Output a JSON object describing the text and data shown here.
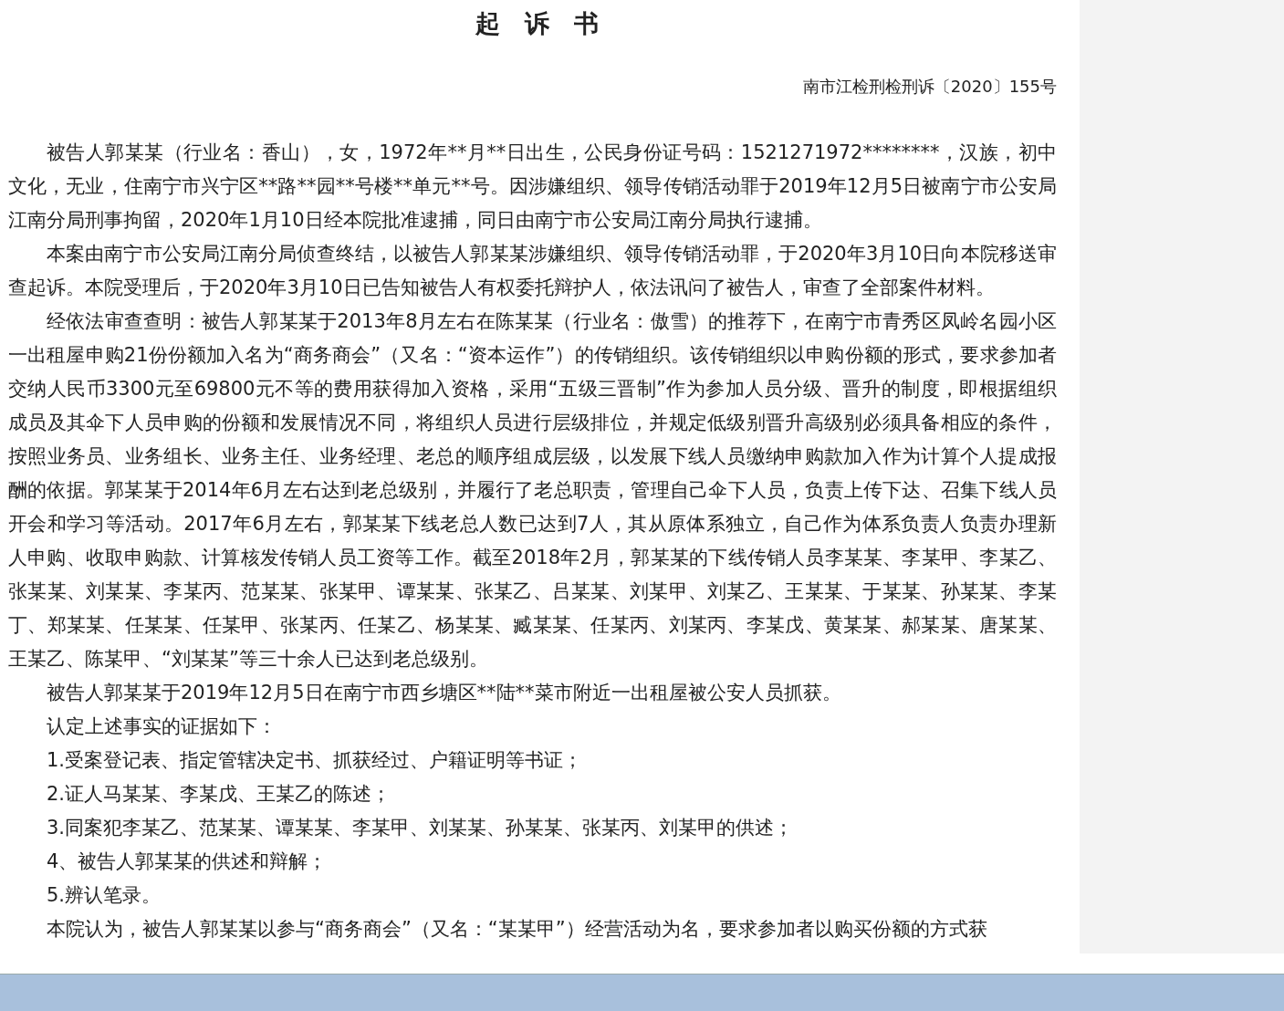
{
  "document": {
    "title": "起　诉　书",
    "case_number": "南市江检刑检刑诉〔2020〕155号",
    "paragraphs": [
      "被告人郭某某（行业名：香山），女，1972年**月**日出生，公民身份证号码：1521271972********，汉族，初中文化，无业，住南宁市兴宁区**路**园**号楼**单元**号。因涉嫌组织、领导传销活动罪于2019年12月5日被南宁市公安局江南分局刑事拘留，2020年1月10日经本院批准逮捕，同日由南宁市公安局江南分局执行逮捕。",
      "本案由南宁市公安局江南分局侦查终结，以被告人郭某某涉嫌组织、领导传销活动罪，于2020年3月10日向本院移送审查起诉。本院受理后，于2020年3月10日已告知被告人有权委托辩护人，依法讯问了被告人，审查了全部案件材料。",
      "经依法审查查明：被告人郭某某于2013年8月左右在陈某某（行业名：傲雪）的推荐下，在南宁市青秀区凤岭名园小区一出租屋申购21份份额加入名为“商务商会”（又名：“资本运作”）的传销组织。该传销组织以申购份额的形式，要求参加者交纳人民币3300元至69800元不等的费用获得加入资格，采用“五级三晋制”作为参加人员分级、晋升的制度，即根据组织成员及其伞下人员申购的份额和发展情况不同，将组织人员进行层级排位，并规定低级别晋升高级别必须具备相应的条件，按照业务员、业务组长、业务主任、业务经理、老总的顺序组成层级，以发展下线人员缴纳申购款加入作为计算个人提成报酬的依据。郭某某于2014年6月左右达到老总级别，并履行了老总职责，管理自己伞下人员，负责上传下达、召集下线人员开会和学习等活动。2017年6月左右，郭某某下线老总人数已达到7人，其从原体系独立，自己作为体系负责人负责办理新人申购、收取申购款、计算核发传销人员工资等工作。截至2018年2月，郭某某的下线传销人员李某某、李某甲、李某乙、张某某、刘某某、李某丙、范某某、张某甲、谭某某、张某乙、吕某某、刘某甲、刘某乙、王某某、于某某、孙某某、李某丁、郑某某、任某某、任某甲、张某丙、任某乙、杨某某、臧某某、任某丙、刘某丙、李某戊、黄某某、郝某某、唐某某、王某乙、陈某甲、“刘某某”等三十余人已达到老总级别。",
      "被告人郭某某于2019年12月5日在南宁市西乡塘区**陆**菜市附近一出租屋被公安人员抓获。",
      "认定上述事实的证据如下：",
      "1.受案登记表、指定管辖决定书、抓获经过、户籍证明等书证；",
      "2.证人马某某、李某戊、王某乙的陈述；",
      "3.同案犯李某乙、范某某、谭某某、李某甲、刘某某、孙某某、张某丙、刘某甲的供述；",
      "4、被告人郭某某的供述和辩解；",
      "5.辨认笔录。",
      "本院认为，被告人郭某某以参与“商务商会”（又名：“某某甲”）经营活动为名，要求参加者以购买份额的方式获"
    ]
  }
}
